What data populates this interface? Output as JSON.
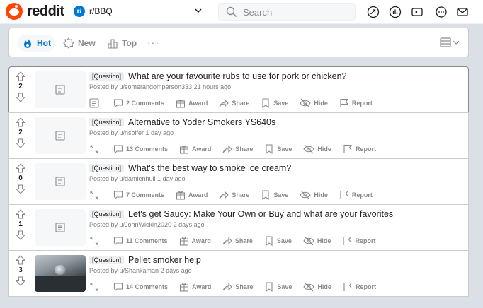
{
  "header": {
    "logo_text": "reddit",
    "community_icon_letter": "r/",
    "community_name": "r/BBQ",
    "search_placeholder": "Search",
    "icons": [
      "popular-icon",
      "coins-icon",
      "video-icon",
      "chat-icon",
      "message-icon"
    ]
  },
  "sort": {
    "hot": "Hot",
    "new": "New",
    "top": "Top",
    "more": "···"
  },
  "action_labels": {
    "share": "Share",
    "save": "Save",
    "hide": "Hide",
    "report": "Report",
    "award": "Award"
  },
  "posts": [
    {
      "score": "2",
      "flair": "[Question]",
      "title": "What are your favourite rubs to use for pork or chicken?",
      "meta": "Posted by u/somerandomperson333 21 hours ago",
      "comments": "2 Comments",
      "thumb": "text"
    },
    {
      "score": "2",
      "flair": "[Question]",
      "title": "Alternative to Yoder Smokers YS640s",
      "meta": "Posted by u/nsoifer 1 day ago",
      "comments": "13 Comments",
      "thumb": "text"
    },
    {
      "score": "0",
      "flair": "[Question]",
      "title": "What's the best way to smoke ice cream?",
      "meta": "Posted by u/damienhull 1 day ago",
      "comments": "7 Comments",
      "thumb": "text"
    },
    {
      "score": "1",
      "flair": "[Question]",
      "title": "Let's get Saucy: Make Your Own or Buy and what are your favorites",
      "meta": "Posted by u/JohnWickin2020 2 days ago",
      "comments": "11 Comments",
      "thumb": "text"
    },
    {
      "score": "3",
      "flair": "[Question]",
      "title": "Pellet smoker help",
      "meta": "Posted by u/Shankaman 2 days ago",
      "comments": "14 Comments",
      "thumb": "image"
    }
  ]
}
